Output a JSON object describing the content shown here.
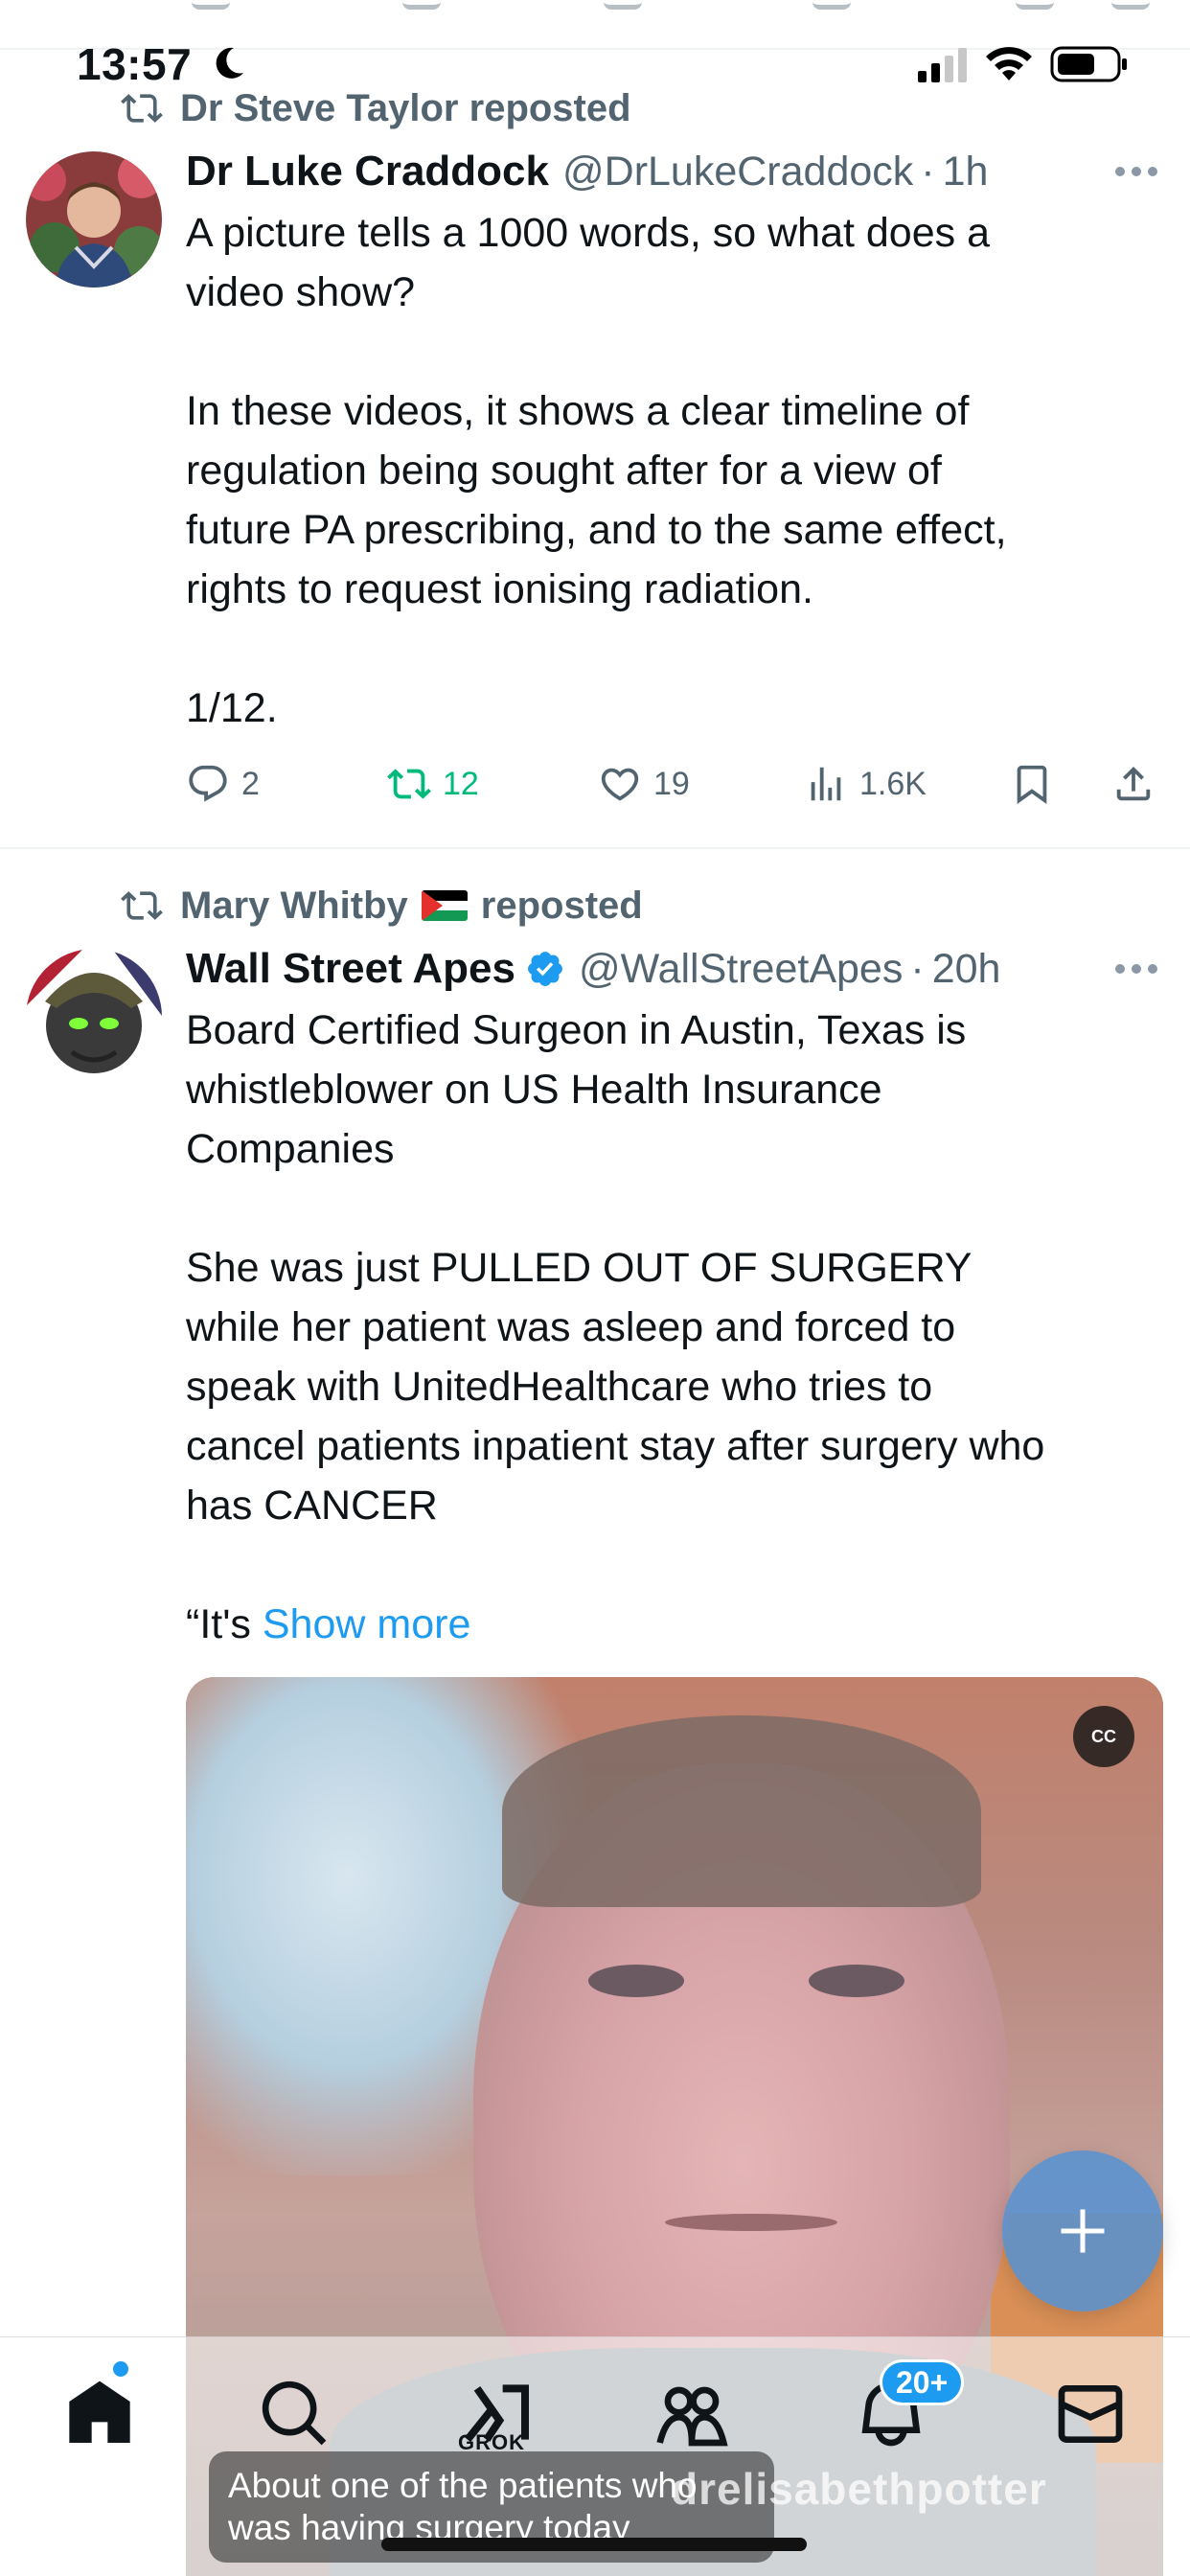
{
  "status_bar": {
    "time": "13:57",
    "moon_icon": "moon-icon",
    "signal_icon": "cellular-signal-icon",
    "wifi_icon": "wifi-icon",
    "battery_icon": "battery-icon"
  },
  "tweets": [
    {
      "reposted_by": "Dr Steve Taylor",
      "reposted_suffix": "reposted",
      "author_name": "Dr Luke Craddock",
      "handle": "@DrLukeCraddock",
      "separator": "·",
      "age": "1h",
      "body": "A picture tells a 1000 words, so what does a\nvideo show?\n\nIn these videos, it shows a clear timeline of\nregulation being sought after for a view of\nfuture PA prescribing, and to the same effect,\nrights to request ionising radiation.\n\n1/12.",
      "replies": "2",
      "reposts": "12",
      "likes": "19",
      "views": "1.6K"
    },
    {
      "reposted_by": "Mary Whitby",
      "reposted_suffix": "reposted",
      "author_name": "Wall Street Apes",
      "handle": "@WallStreetApes",
      "separator": "·",
      "age": "20h",
      "body": "Board Certified Surgeon in Austin, Texas is\nwhistleblower on US Health Insurance\nCompanies\n\nShe was just PULLED OUT OF SURGERY\nwhile her patient was asleep and forced to\nspeak with UnitedHealthcare who tries to\ncancel patients inpatient stay after surgery who\nhas CANCER\n\n“It's ",
      "show_more": "Show more",
      "media": {
        "cc_label": "CC",
        "subtitle": "About one of the patients who\nwas having surgery today",
        "watermark": "drelisabethpotter"
      }
    }
  ],
  "bottom_nav": {
    "grok_label": "GROK",
    "notifications_badge": "20+"
  },
  "colors": {
    "accent": "#1d9bf0",
    "repost_green": "#00ba7c",
    "secondary_text": "#536471"
  }
}
